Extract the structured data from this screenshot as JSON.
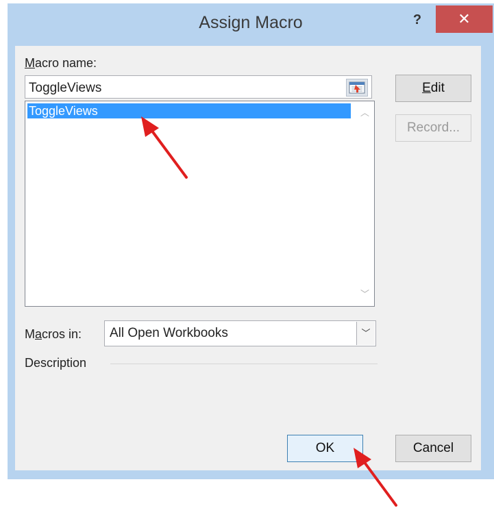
{
  "dialog": {
    "title": "Assign Macro",
    "help_glyph": "?",
    "close_glyph": "✕"
  },
  "macro_name": {
    "label_accel": "M",
    "label_rest": "acro name:",
    "value": "ToggleViews"
  },
  "macro_list": {
    "items": [
      "ToggleViews"
    ],
    "selected_index": 0
  },
  "buttons": {
    "edit_accel": "E",
    "edit_rest": "dit",
    "record": "Record...",
    "ok": "OK",
    "cancel": "Cancel"
  },
  "macros_in": {
    "label_pre": "M",
    "label_accel": "a",
    "label_rest": "cros in:",
    "value": "All Open Workbooks"
  },
  "description": {
    "label": "Description"
  },
  "colors": {
    "frame": "#b7d3ef",
    "close": "#c75050",
    "selection": "#3399ff",
    "annotation_arrow": "#e01f1f"
  }
}
